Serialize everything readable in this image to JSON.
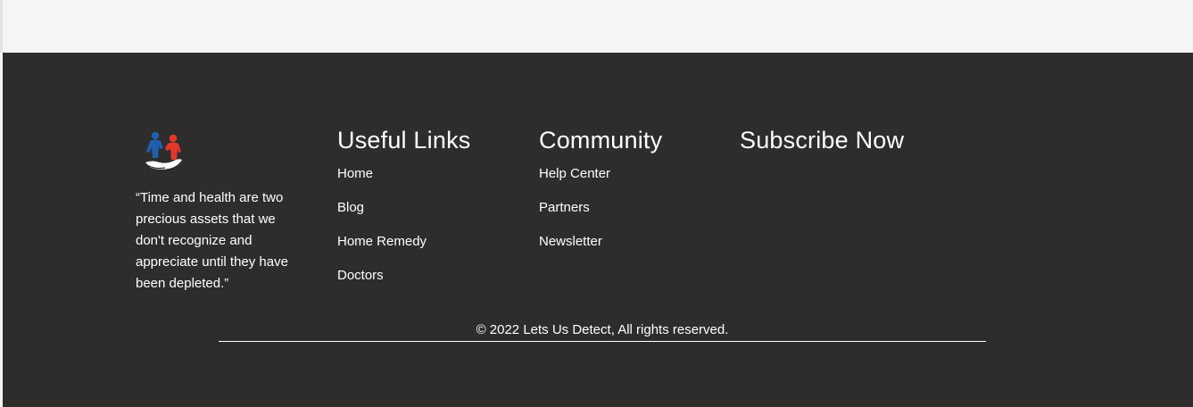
{
  "footer": {
    "logo_icon": "people-helping-hand-icon",
    "quote": "“Time and health are two precious assets that we don't recognize and appreciate until they have been depleted.”",
    "useful_links": {
      "title": "Useful Links",
      "items": [
        "Home",
        "Blog",
        "Home Remedy",
        "Doctors"
      ]
    },
    "community": {
      "title": "Community",
      "items": [
        "Help Center",
        "Partners",
        "Newsletter"
      ]
    },
    "subscribe": {
      "title": "Subscribe Now"
    },
    "copyright": "© 2022 Lets Us Detect, All rights reserved."
  },
  "colors": {
    "footer_bg": "#2e2d2c",
    "page_bg": "#f5f5f5",
    "logo_blue": "#1f5fae",
    "logo_red": "#e2382a"
  }
}
